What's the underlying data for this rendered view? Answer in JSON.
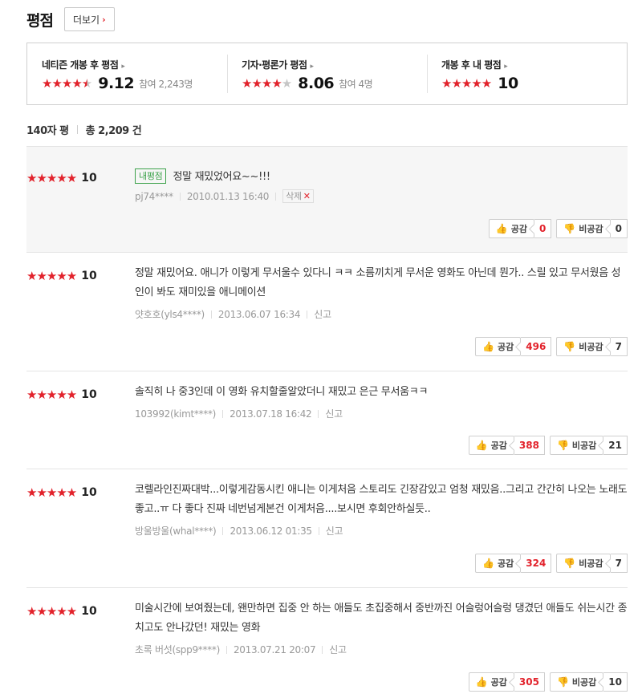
{
  "header": {
    "title": "평점",
    "more_label": "더보기",
    "more_arrow": "›"
  },
  "scores": [
    {
      "label": "네티즌 개봉 후 평점",
      "stars": 4.5,
      "score": "9.12",
      "participants": "참여 2,243명"
    },
    {
      "label": "기자·평론가 평점",
      "stars": 4,
      "score": "8.06",
      "participants": "참여 4명"
    },
    {
      "label": "개봉 후 내 평점",
      "stars": 5,
      "score": "10",
      "participants": ""
    }
  ],
  "summary": {
    "type_label": "140자 평",
    "total_label": "총 2,209 건"
  },
  "vote_labels": {
    "agree": "공감",
    "disagree": "비공감"
  },
  "my_review": {
    "badge": "내평점",
    "score": "10",
    "text": "정말 재밌었어요~~!!!",
    "user": "pj74****",
    "date": "2010.01.13 16:40",
    "delete_label": "삭제",
    "agree": "0",
    "disagree": "0"
  },
  "reviews": [
    {
      "score": "10",
      "text": "정말 재밌어요. 애니가 이렇게 무서울수 있다니 ㅋㅋ 소름끼치게 무서운 영화도 아닌데 뭔가.. 스릴 있고 무서웠음 성인이 봐도 재미있을 애니메이션",
      "user": "얏호호(yls4****)",
      "date": "2013.06.07 16:34",
      "report": "신고",
      "agree": "496",
      "disagree": "7"
    },
    {
      "score": "10",
      "text": "솔직히 나 중3인데 이 영화 유치할줄알았더니 재밌고 은근 무서움ㅋㅋ",
      "user": "103992(kimt****)",
      "date": "2013.07.18 16:42",
      "report": "신고",
      "agree": "388",
      "disagree": "21"
    },
    {
      "score": "10",
      "text": "코렐라인진짜대박...이렇게감동시킨 애니는 이게처음 스토리도 긴장감있고 엄청 재밌음..그리고 간간히 나오는 노래도 좋고..ㅠ 다 좋다 진짜 네번넘게본건 이게처음....보시면 후회안하실듯..",
      "user": "방울방울(whal****)",
      "date": "2013.06.12 01:35",
      "report": "신고",
      "agree": "324",
      "disagree": "7"
    },
    {
      "score": "10",
      "text": "미술시간에 보여줬는데, 왠만하면 집중 안 하는 애들도 초집중해서 중반까진 어슬렁어슬렁 댕겼던 애들도 쉬는시간 종치고도 안나갔던! 재밌는 영화",
      "user": "초록 버섯(spp9****)",
      "date": "2013.07.21 20:07",
      "report": "신고",
      "agree": "305",
      "disagree": "10"
    }
  ]
}
